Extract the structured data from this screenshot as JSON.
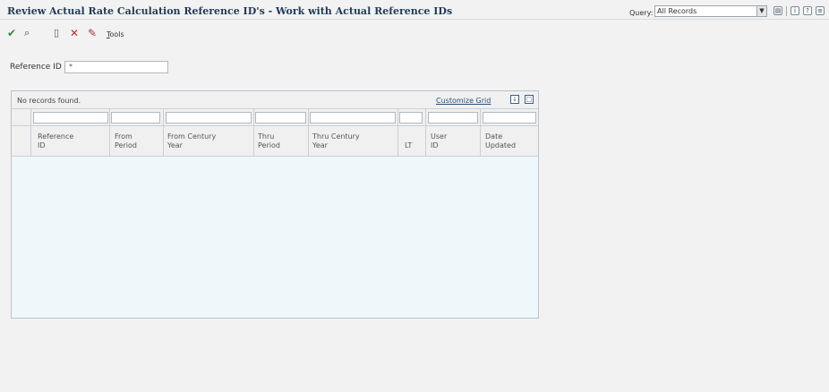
{
  "header": {
    "title": "Review Actual Rate Calculation Reference ID's - Work with Actual Reference IDs",
    "query_label": "Query:",
    "query_value": "All Records"
  },
  "toolbar": {
    "tools_label": "Tools",
    "icons": [
      "select-check-icon",
      "find-icon",
      "delete-icon",
      "close-icon",
      "tools-icon"
    ]
  },
  "form": {
    "reference_id_label": "Reference ID",
    "reference_id_value": "*"
  },
  "grid": {
    "status": "No records found.",
    "customize_label": "Customize Grid",
    "columns": [
      {
        "line1": "Reference",
        "line2": "ID"
      },
      {
        "line1": "From",
        "line2": "Period"
      },
      {
        "line1": "From Century",
        "line2": "Year"
      },
      {
        "line1": "Thru",
        "line2": "Period"
      },
      {
        "line1": "Thru Century",
        "line2": "Year"
      },
      {
        "line1": "",
        "line2": "LT"
      },
      {
        "line1": "User",
        "line2": "ID"
      },
      {
        "line1": "Date",
        "line2": "Updated"
      }
    ]
  },
  "colors": {
    "title": "#1f3b57",
    "check": "#2e8b2e",
    "close": "#d9251d",
    "grid_body": "#eef8fb"
  }
}
